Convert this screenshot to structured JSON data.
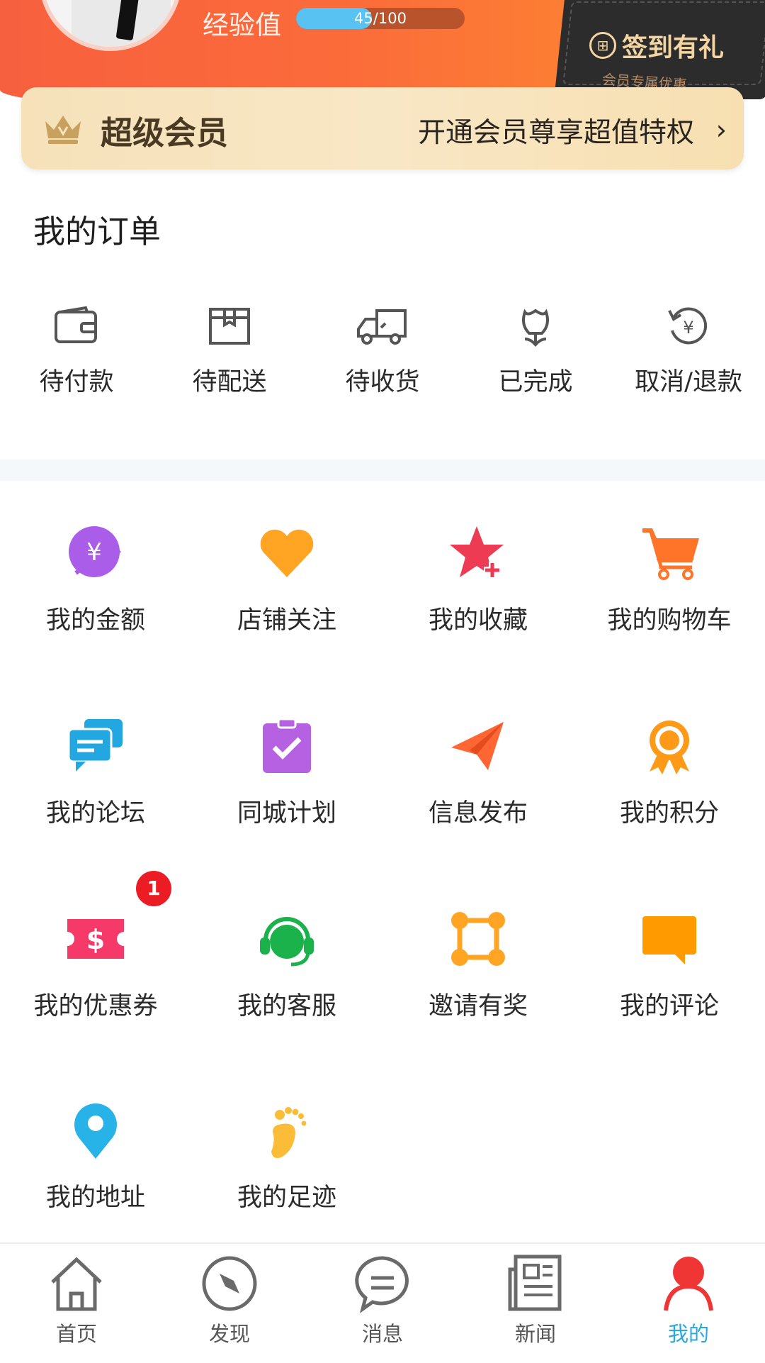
{
  "header": {
    "exp_label": "经验值",
    "exp_text": "45/100",
    "exp_progress": 0.45,
    "signin_label": "签到有礼",
    "signin_sub": "会员专属优惠"
  },
  "vip": {
    "title": "超级会员",
    "promo": "开通会员尊享超值特权",
    "chevron": "›"
  },
  "orders": {
    "title": "我的订单",
    "items": [
      {
        "label": "待付款",
        "icon": "wallet-icon"
      },
      {
        "label": "待配送",
        "icon": "package-icon"
      },
      {
        "label": "待收货",
        "icon": "truck-icon"
      },
      {
        "label": "已完成",
        "icon": "flower-icon"
      },
      {
        "label": "取消/退款",
        "icon": "refund-icon"
      }
    ]
  },
  "services": [
    {
      "label": "我的金额",
      "icon": "money-icon"
    },
    {
      "label": "店铺关注",
      "icon": "heart-icon"
    },
    {
      "label": "我的收藏",
      "icon": "star-plus-icon"
    },
    {
      "label": "我的购物车",
      "icon": "cart-icon"
    },
    {
      "label": "我的论坛",
      "icon": "chat-icon"
    },
    {
      "label": "同城计划",
      "icon": "clipboard-check-icon"
    },
    {
      "label": "信息发布",
      "icon": "paper-plane-icon"
    },
    {
      "label": "我的积分",
      "icon": "medal-icon"
    },
    {
      "label": "我的优惠券",
      "icon": "coupon-icon",
      "badge": "1"
    },
    {
      "label": "我的客服",
      "icon": "headset-icon"
    },
    {
      "label": "邀请有奖",
      "icon": "share-nodes-icon"
    },
    {
      "label": "我的评论",
      "icon": "comment-icon"
    },
    {
      "label": "我的地址",
      "icon": "location-pin-icon"
    },
    {
      "label": "我的足迹",
      "icon": "footprint-icon"
    }
  ],
  "colors": {
    "header_start": "#f7603e",
    "header_end": "#fd8f2d",
    "accent_blue": "#29a8e0",
    "badge_red": "#ec1c24"
  },
  "nav": [
    {
      "label": "首页",
      "icon": "home-icon",
      "active": false
    },
    {
      "label": "发现",
      "icon": "compass-icon",
      "active": false
    },
    {
      "label": "消息",
      "icon": "message-icon",
      "active": false
    },
    {
      "label": "新闻",
      "icon": "newspaper-icon",
      "active": false
    },
    {
      "label": "我的",
      "icon": "user-icon",
      "active": true
    }
  ]
}
